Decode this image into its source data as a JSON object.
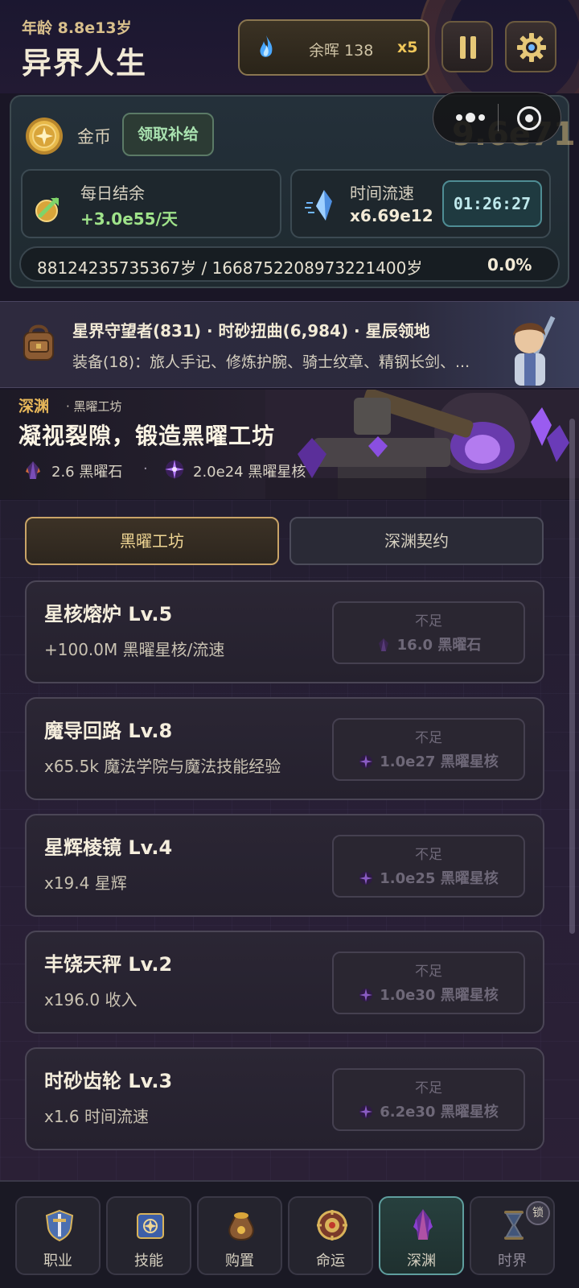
{
  "header": {
    "age": "年龄 8.8e13岁",
    "title": "异界人生",
    "ember_label": "余晖 138",
    "ember_multiplier": "x5"
  },
  "gold": {
    "label": "金币",
    "claim_button": "领取补给",
    "value": "9.6e71",
    "daily_label": "每日结余",
    "daily_value": "+3.0e55/天",
    "speed_label": "时间流速",
    "speed_value": "x6.69e12",
    "timer": "01:26:27",
    "life_text": "88124235735367岁 / 1668752208973221400岁",
    "life_percent": "0.0%"
  },
  "info": {
    "line1": "星界守望者(831) · 时砂扭曲(6,984) · 星辰领地",
    "line2": "装备(18)：旅人手记、修炼护腕、骑士纹章、精钢长剑、..."
  },
  "abyss": {
    "tag": "深渊",
    "subtitle": "· 黑曜工坊",
    "headline": "凝视裂隙，锻造黑曜工坊",
    "resource1": "2.6 黑曜石",
    "separator": "·",
    "resource2": "2.0e24 黑曜星核"
  },
  "tabs": [
    {
      "label": "黑曜工坊",
      "active": true
    },
    {
      "label": "深渊契约",
      "active": false
    }
  ],
  "upgrades": [
    {
      "name": "星核熔炉 Lv.5",
      "desc": "+100.0M 黑曜星核/流速",
      "state": "不足",
      "cost": "16.0 黑曜石",
      "cost_icon": "obsidian-icon"
    },
    {
      "name": "魔导回路 Lv.8",
      "desc": "x65.5k 魔法学院与魔法技能经验",
      "state": "不足",
      "cost": "1.0e27 黑曜星核",
      "cost_icon": "star-core-icon"
    },
    {
      "name": "星辉棱镜 Lv.4",
      "desc": "x19.4 星辉",
      "state": "不足",
      "cost": "1.0e25 黑曜星核",
      "cost_icon": "star-core-icon"
    },
    {
      "name": "丰饶天秤 Lv.2",
      "desc": "x196.0 收入",
      "state": "不足",
      "cost": "1.0e30 黑曜星核",
      "cost_icon": "star-core-icon"
    },
    {
      "name": "时砂齿轮 Lv.3",
      "desc": "x1.6 时间流速",
      "state": "不足",
      "cost": "6.2e30 黑曜星核",
      "cost_icon": "star-core-icon"
    }
  ],
  "nav": [
    {
      "label": "职业",
      "icon": "shield-sword-icon"
    },
    {
      "label": "技能",
      "icon": "spellbook-icon"
    },
    {
      "label": "购置",
      "icon": "treasure-bag-icon"
    },
    {
      "label": "命运",
      "icon": "fate-wheel-icon"
    },
    {
      "label": "深渊",
      "icon": "abyss-crystal-icon",
      "active": true
    },
    {
      "label": "时界",
      "icon": "hourglass-icon",
      "locked": true,
      "badge": "锁"
    }
  ],
  "colors": {
    "accent_gold": "#c9a467",
    "positive_green": "#9fe38a",
    "active_teal": "#5f9e9e",
    "abyss_orange": "#e8b85a"
  }
}
